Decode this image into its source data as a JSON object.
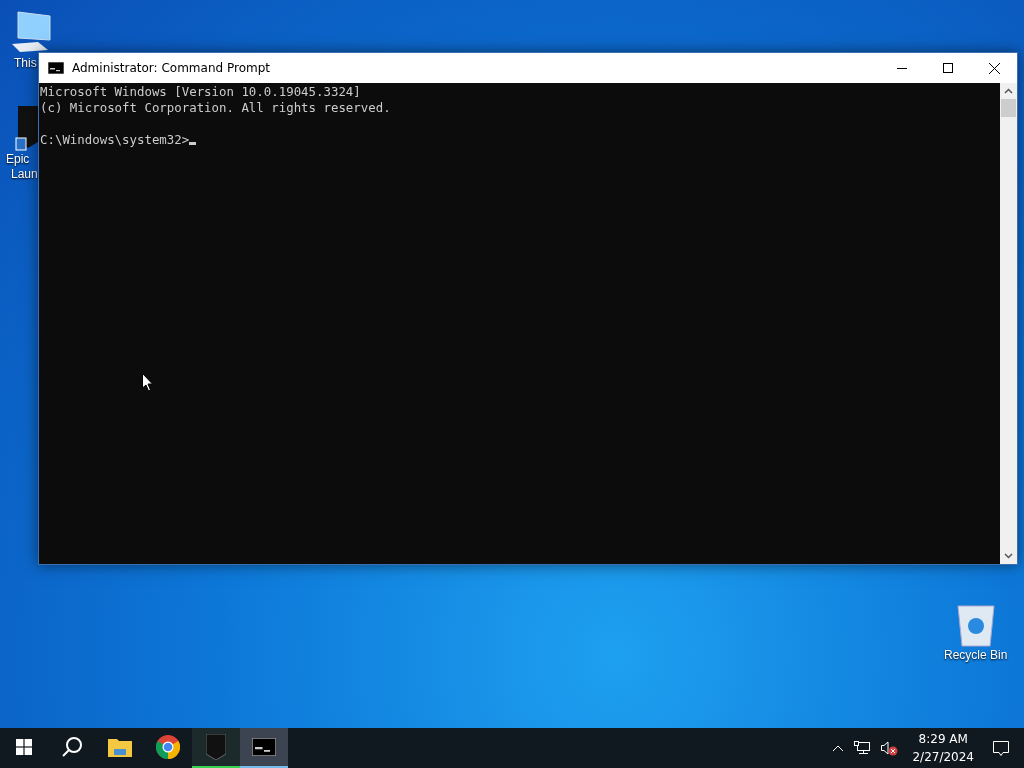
{
  "desktop": {
    "icons": [
      {
        "kind": "computer",
        "label": "This"
      },
      {
        "kind": "epic",
        "label": "Epic",
        "label_2": "Laun"
      },
      {
        "kind": "recycle",
        "label": "Recycle Bin"
      }
    ]
  },
  "window": {
    "title": "Administrator: Command Prompt",
    "console": {
      "banner": [
        "Microsoft Windows [Version 10.0.19045.3324]",
        "(c) Microsoft Corporation. All rights reserved."
      ],
      "prompt": "C:\\Windows\\system32>"
    }
  },
  "taskbar": {
    "apps": [
      {
        "kind": "start",
        "selected": false,
        "running": false
      },
      {
        "kind": "search",
        "selected": false,
        "running": false
      },
      {
        "kind": "explorer",
        "selected": false,
        "running": false
      },
      {
        "kind": "chrome",
        "selected": false,
        "running": false
      },
      {
        "kind": "epic",
        "selected": false,
        "running": true
      },
      {
        "kind": "cmd",
        "selected": true,
        "running": true
      }
    ],
    "tray": {
      "time": "8:29 AM",
      "date": "2/27/2024",
      "volume_muted": true
    }
  }
}
